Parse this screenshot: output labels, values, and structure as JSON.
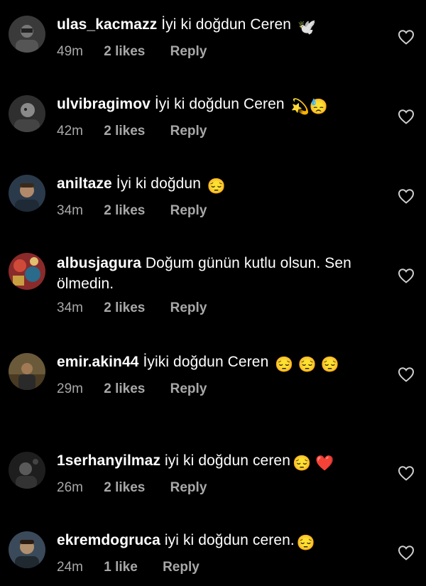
{
  "comments": [
    {
      "username": "ulas_kacmazz",
      "text": "İyi ki doğdun Ceren",
      "emoji": "🕊️",
      "time": "49m",
      "likes": "2 likes",
      "reply": "Reply"
    },
    {
      "username": "ulvibragimov",
      "text": "İyi ki doğdun Ceren",
      "emoji": "💫😓",
      "time": "42m",
      "likes": "2 likes",
      "reply": "Reply"
    },
    {
      "username": "aniltaze",
      "text": "İyi ki doğdun",
      "emoji": "😔",
      "time": "34m",
      "likes": "2 likes",
      "reply": "Reply"
    },
    {
      "username": "albusjagura",
      "text": "Doğum günün kutlu olsun. Sen ölmedin.",
      "emoji": "",
      "time": "34m",
      "likes": "2 likes",
      "reply": "Reply"
    },
    {
      "username": "emir.akin44",
      "text": "İyiki doğdun Ceren",
      "emoji": "😔 😔 😔",
      "time": "29m",
      "likes": "2 likes",
      "reply": "Reply"
    },
    {
      "username": "1serhanyilmaz",
      "text": "iyi ki doğdun ceren",
      "emoji": "😔 ❤️",
      "time": "26m",
      "likes": "2 likes",
      "reply": "Reply"
    },
    {
      "username": "ekremdogruca",
      "text": "iyi ki doğdun ceren.",
      "emoji": "😔",
      "time": "24m",
      "likes": "1 like",
      "reply": "Reply"
    }
  ],
  "colors": {
    "background": "#000000",
    "text": "#ffffff",
    "meta": "#a8a8a8"
  },
  "icons": {
    "like": "heart-outline-icon"
  }
}
